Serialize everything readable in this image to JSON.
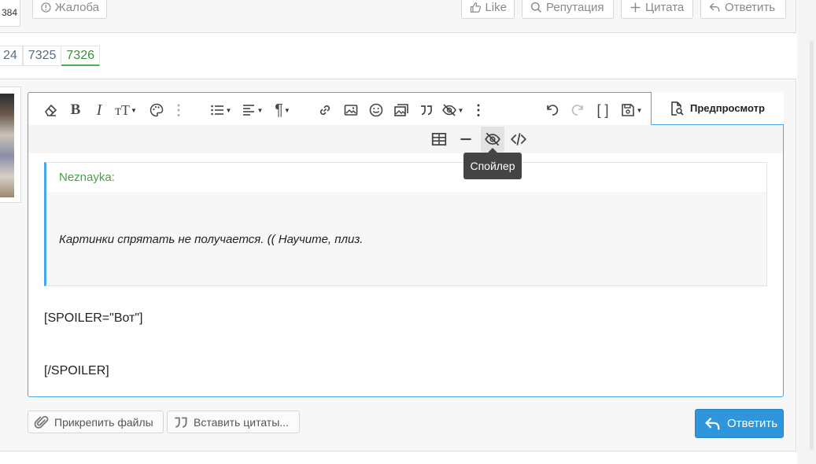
{
  "post_actions": {
    "user_count": "384",
    "report_label": "Жалоба",
    "like_label": "Like",
    "reputation_label": "Репутация",
    "quote_label": "Цитата",
    "reply_label": "Ответить"
  },
  "pagination": {
    "pages": [
      "24",
      "7325",
      "7326"
    ],
    "current": "7326"
  },
  "editor": {
    "preview_label": "Предпросмотр",
    "tooltip": "Спойлер",
    "quote_author": "Neznayka:",
    "quote_text": "Картинки спрятать не получается. (( Научите, плиз.",
    "lines": [
      "[SPOILER=\"Вот\"]",
      "[/SPOILER]"
    ]
  },
  "footer": {
    "attach_label": "Прикрепить файлы",
    "insert_quotes_label": "Вставить цитаты...",
    "submit_label": "Ответить"
  },
  "icons": {
    "toolbar1": [
      "eraser-icon",
      "bold-icon",
      "italic-icon",
      "font-size-icon",
      "palette-icon",
      "more-vertical-icon",
      "list-icon",
      "align-icon",
      "paragraph-icon",
      "link-icon",
      "image-icon",
      "smile-icon",
      "media-icon",
      "quote-icon",
      "spoiler-icon",
      "more-vertical-icon",
      "undo-icon",
      "redo-icon",
      "fullscreen-icon",
      "save-draft-icon"
    ],
    "toolbar2": [
      "table-icon",
      "horizontal-rule-icon",
      "inline-spoiler-icon",
      "code-icon"
    ]
  },
  "colors": {
    "accent": "#47a7eb",
    "button": "#2f96dc",
    "quote_author": "#4aa04a"
  }
}
